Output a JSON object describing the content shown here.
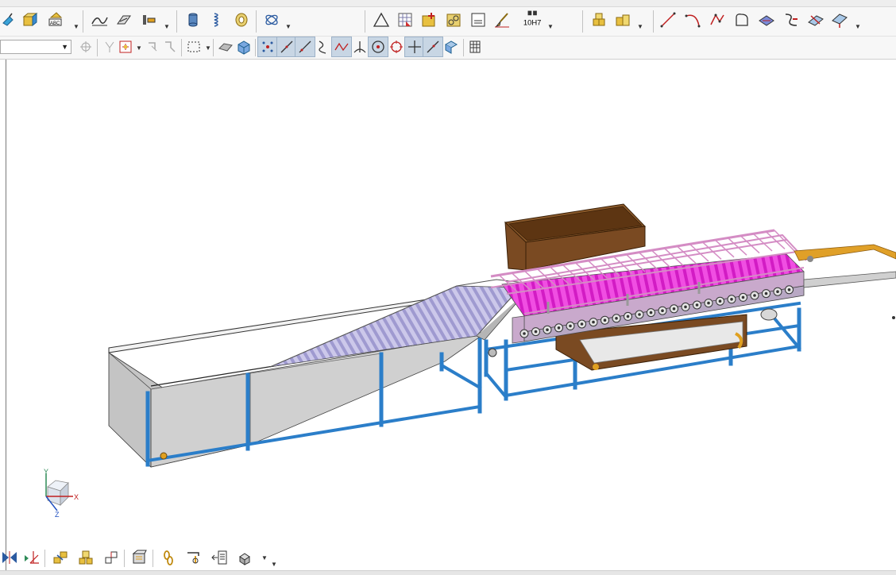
{
  "toolbar_top": {
    "tools": [
      {
        "name": "sheet-metal-tool-icon"
      },
      {
        "name": "box-feature-icon"
      },
      {
        "name": "text-abc-icon"
      },
      {
        "name": "surface-sweep-icon"
      },
      {
        "name": "surface-loft-icon"
      },
      {
        "name": "gear-train-icon"
      },
      {
        "name": "cylinder-part-icon"
      },
      {
        "name": "spring-icon"
      },
      {
        "name": "ring-bearing-icon"
      },
      {
        "name": "coil-spring-icon"
      },
      {
        "name": "triangle-icon"
      },
      {
        "name": "table-grid-icon"
      },
      {
        "name": "add-feature-icon"
      },
      {
        "name": "gears-icon"
      },
      {
        "name": "note-sheet-icon"
      },
      {
        "name": "paint-brush-icon"
      },
      {
        "name": "measure-icon"
      },
      {
        "name": "tolerance-icon"
      },
      {
        "name": "component-icon"
      },
      {
        "name": "component-dropdown-icon"
      },
      {
        "name": "line-tool-icon"
      },
      {
        "name": "arc-tool-icon"
      },
      {
        "name": "polyline-tool-icon"
      },
      {
        "name": "face-outline-icon"
      },
      {
        "name": "curve-surface-icon"
      },
      {
        "name": "split-tool-icon"
      },
      {
        "name": "intersect-icon"
      },
      {
        "name": "fold-tool-icon"
      }
    ],
    "tolerance_label": "10H7"
  },
  "toolbar_second": {
    "tools": [
      {
        "name": "filter-icon"
      },
      {
        "name": "filter-alt-icon"
      },
      {
        "name": "snap-point-icon"
      },
      {
        "name": "transform-icon"
      },
      {
        "name": "transform-alt-icon"
      },
      {
        "name": "select-box-icon"
      },
      {
        "name": "solid-view-icon"
      },
      {
        "name": "cube-view-icon"
      },
      {
        "name": "snap-grid-icon"
      },
      {
        "name": "snap-line-icon"
      },
      {
        "name": "snap-edge-icon"
      },
      {
        "name": "snap-curve-icon"
      },
      {
        "name": "snap-polyline-icon"
      },
      {
        "name": "snap-perpendicular-icon"
      },
      {
        "name": "snap-center-icon"
      },
      {
        "name": "snap-circle-icon"
      },
      {
        "name": "snap-plus-icon"
      },
      {
        "name": "snap-tangent-icon"
      },
      {
        "name": "snap-reset-icon"
      },
      {
        "name": "grid-table-icon"
      }
    ]
  },
  "toolbar_bottom": {
    "tools": [
      {
        "name": "mirror-icon"
      },
      {
        "name": "align-icon"
      },
      {
        "name": "pattern-icon"
      },
      {
        "name": "parts-icon"
      },
      {
        "name": "assembly-step-icon"
      },
      {
        "name": "explode-icon"
      },
      {
        "name": "chain-icon"
      },
      {
        "name": "path-tool-icon"
      },
      {
        "name": "properties-icon"
      },
      {
        "name": "blocks-icon"
      }
    ]
  },
  "axis": {
    "x_label": "X",
    "y_label": "Y",
    "z_label": "Z"
  },
  "colors": {
    "frame_blue": "#2b7ec9",
    "hopper_gray": "#c6c6c6",
    "roller_lavender": "#b8b4dc",
    "roller_magenta": "#ee22dd",
    "rail_pink": "#e8a8d8",
    "crate_brown": "#7a4a22",
    "chute_orange": "#d8952a"
  }
}
